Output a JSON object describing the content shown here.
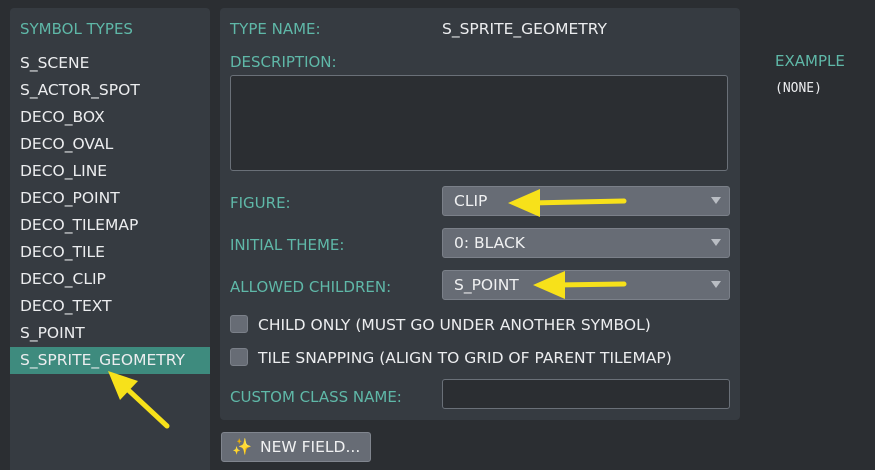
{
  "sidebar": {
    "title": "SYMBOL TYPES",
    "items": [
      {
        "label": "S_SCENE"
      },
      {
        "label": "S_ACTOR_SPOT"
      },
      {
        "label": "DECO_BOX"
      },
      {
        "label": "DECO_OVAL"
      },
      {
        "label": "DECO_LINE"
      },
      {
        "label": "DECO_POINT"
      },
      {
        "label": "DECO_TILEMAP"
      },
      {
        "label": "DECO_TILE"
      },
      {
        "label": "DECO_CLIP"
      },
      {
        "label": "DECO_TEXT"
      },
      {
        "label": "S_POINT"
      },
      {
        "label": "S_SPRITE_GEOMETRY",
        "selected": true
      }
    ]
  },
  "form": {
    "type_name_label": "TYPE NAME:",
    "type_name_value": "S_SPRITE_GEOMETRY",
    "description_label": "DESCRIPTION:",
    "description_value": "",
    "figure_label": "FIGURE:",
    "figure_value": "CLIP",
    "initial_theme_label": "INITIAL THEME:",
    "initial_theme_value": "0: BLACK",
    "allowed_children_label": "ALLOWED CHILDREN:",
    "allowed_children_value": "S_POINT",
    "child_only_label": "CHILD ONLY (MUST GO UNDER ANOTHER SYMBOL)",
    "child_only_checked": false,
    "tile_snapping_label": "TILE SNAPPING (ALIGN TO GRID OF PARENT TILEMAP)",
    "tile_snapping_checked": false,
    "custom_class_label": "CUSTOM CLASS NAME:",
    "custom_class_value": ""
  },
  "new_field_button": {
    "icon": "sparkles-icon",
    "label": "NEW FIELD..."
  },
  "example": {
    "title": "EXAMPLE",
    "value": "(NONE)"
  },
  "colors": {
    "accent_teal": "#5fb8a8",
    "selected_bg": "#3e8b7e",
    "annotation_arrow": "#f7e11a"
  }
}
